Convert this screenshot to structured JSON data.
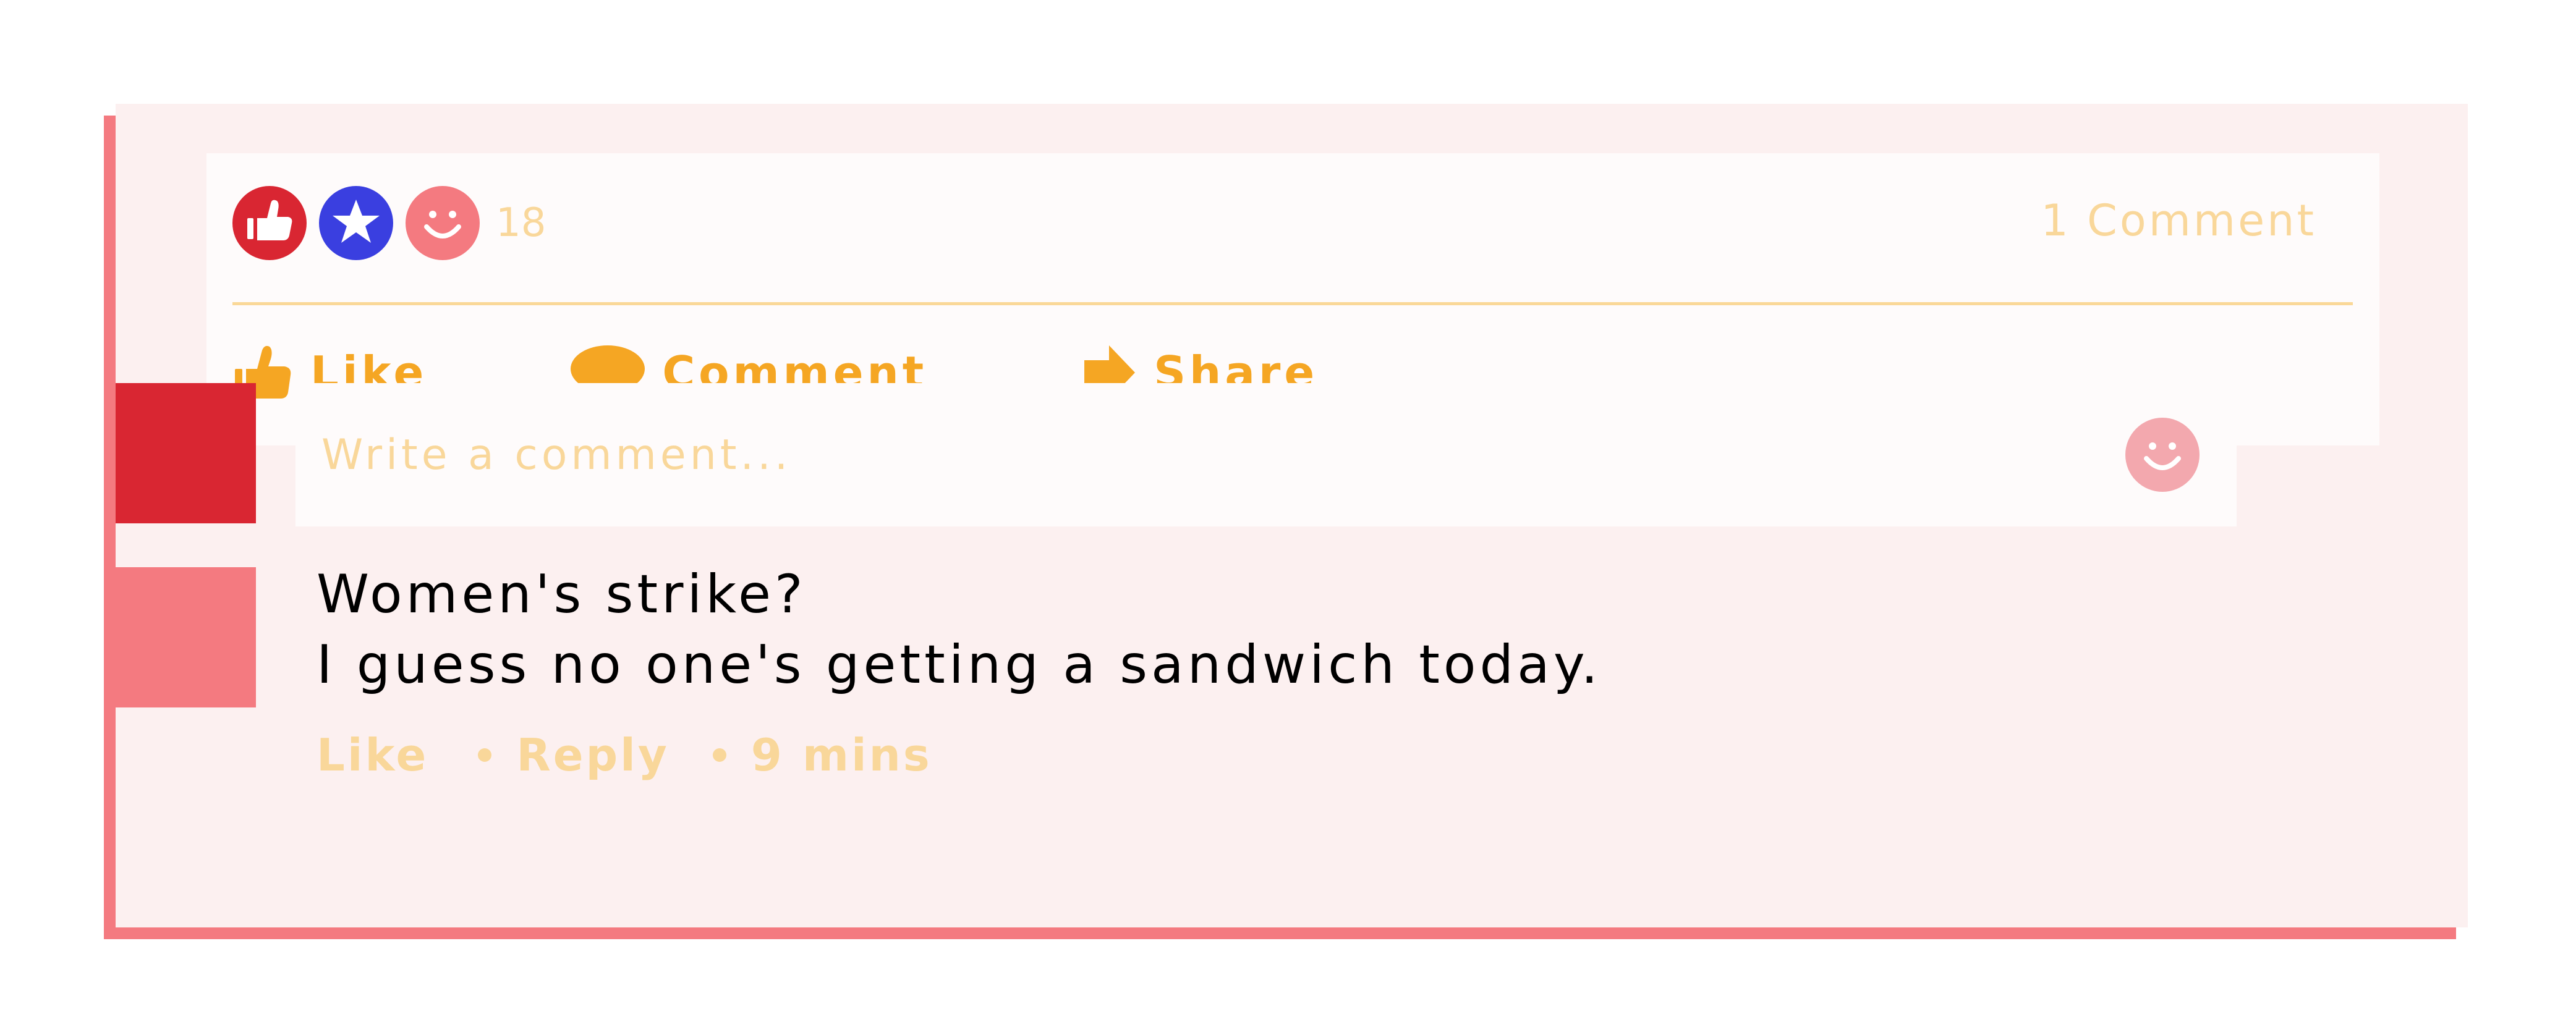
{
  "post": {
    "reactions": {
      "icons": [
        "like-reaction-icon",
        "star-reaction-icon",
        "smile-reaction-icon"
      ],
      "count": "18"
    },
    "comment_count": "1 Comment",
    "actions": {
      "like_label": "Like",
      "comment_label": "Comment",
      "share_label": "Share"
    }
  },
  "composer": {
    "placeholder": "Write a comment..."
  },
  "comment": {
    "lines": [
      "Women's strike?",
      "I guess no one's getting a sandwich today."
    ],
    "like_label": "Like",
    "reply_label": "Reply",
    "time": "9 mins"
  },
  "colors": {
    "accent": "#f5a623",
    "muted": "#f9d79a",
    "red": "#d92632",
    "pink": "#f47a80",
    "blue": "#3a3fe0",
    "card_bg": "#fcf0f0"
  }
}
